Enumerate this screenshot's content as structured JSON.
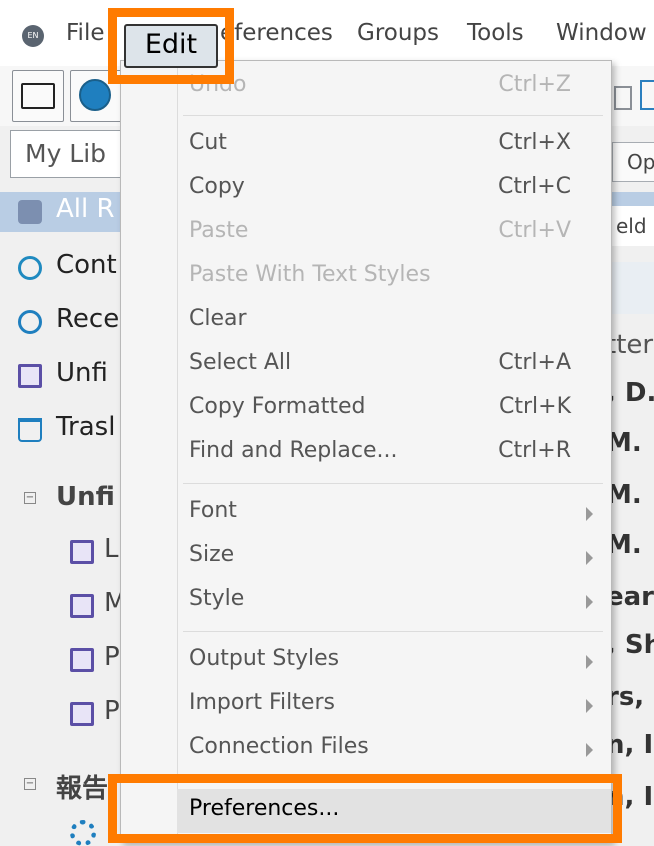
{
  "menubar": {
    "app_icon_text": "EN",
    "items": [
      "File",
      "Edit",
      "Preferences",
      "Groups",
      "Tools",
      "Window"
    ],
    "visible_fragments": {
      "preferences": "eferences"
    }
  },
  "library_select": {
    "value": "My Lib"
  },
  "tree": {
    "all_refs": "All R",
    "contents": "Cont",
    "recent": "Rece",
    "unfiled": "Unfi",
    "trash": "Trasl"
  },
  "groups": [
    {
      "label": "Unfi",
      "children": [
        "L",
        "M",
        "P",
        "P"
      ]
    },
    {
      "label": "報告",
      "children": []
    }
  ],
  "right_pane": {
    "button": "Op",
    "field": "eld",
    "fragments": [
      "tter",
      ", D.",
      "M.",
      "M.",
      "M.",
      "ear",
      ", Sh",
      "rs, I",
      "n, I",
      "n, I"
    ]
  },
  "edit_menu": {
    "groups": [
      [
        {
          "label": "Undo",
          "shortcut": "Ctrl+Z",
          "enabled": false
        }
      ],
      [
        {
          "label": "Cut",
          "shortcut": "Ctrl+X",
          "enabled": true
        },
        {
          "label": "Copy",
          "shortcut": "Ctrl+C",
          "enabled": true
        },
        {
          "label": "Paste",
          "shortcut": "Ctrl+V",
          "enabled": false
        },
        {
          "label": "Paste With Text Styles",
          "shortcut": "",
          "enabled": false
        },
        {
          "label": "Clear",
          "shortcut": "",
          "enabled": true
        },
        {
          "label": "Select All",
          "shortcut": "Ctrl+A",
          "enabled": true
        },
        {
          "label": "Copy Formatted",
          "shortcut": "Ctrl+K",
          "enabled": true
        },
        {
          "label": "Find and Replace...",
          "shortcut": "Ctrl+R",
          "enabled": true
        }
      ],
      [
        {
          "label": "Font",
          "submenu": true,
          "enabled": true
        },
        {
          "label": "Size",
          "submenu": true,
          "enabled": true
        },
        {
          "label": "Style",
          "submenu": true,
          "enabled": true
        }
      ],
      [
        {
          "label": "Output Styles",
          "submenu": true,
          "enabled": true
        },
        {
          "label": "Import Filters",
          "submenu": true,
          "enabled": true
        },
        {
          "label": "Connection Files",
          "submenu": true,
          "enabled": true
        }
      ],
      [
        {
          "label": "Preferences...",
          "shortcut": "",
          "enabled": true,
          "highlighted": true
        }
      ]
    ]
  },
  "annotations": {
    "highlight_color": "#ff7b00"
  }
}
